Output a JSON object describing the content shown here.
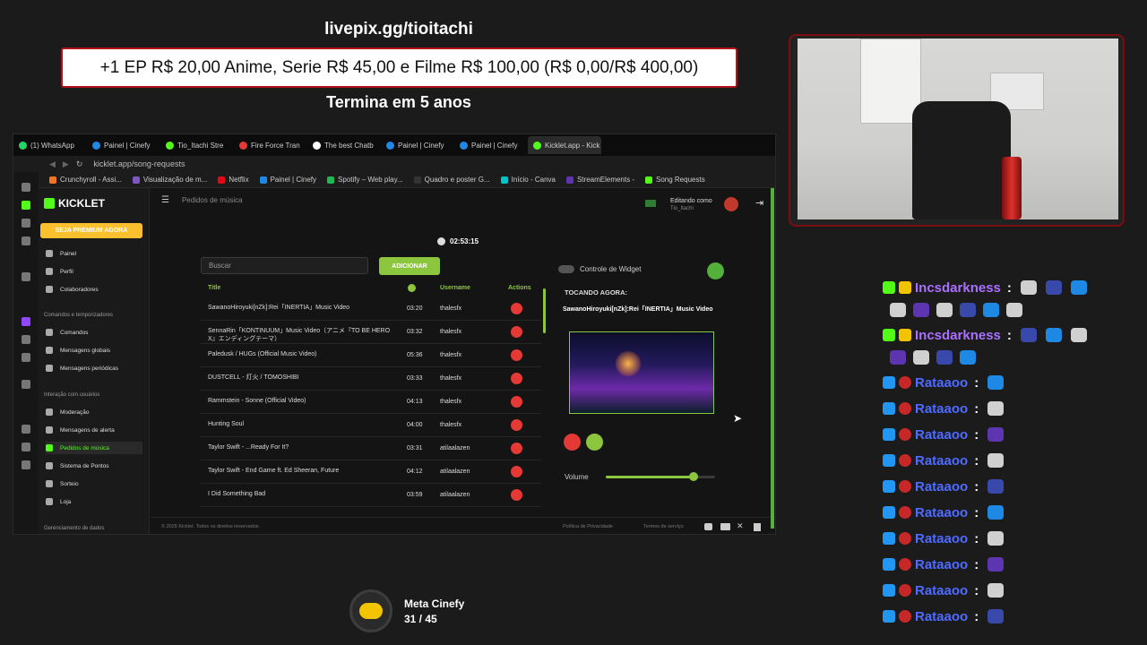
{
  "overlay": {
    "donation_url": "livepix.gg/tioitachi",
    "goal_text": "+1 EP R$ 20,00 Anime, Serie R$ 45,00 e Filme R$ 100,00 (R$ 0,00/R$ 400,00)",
    "ends_text": "Termina em 5 anos"
  },
  "browser": {
    "tabs": [
      {
        "label": "(1) WhatsApp",
        "color": "#25d366"
      },
      {
        "label": "Painel | Cinefy",
        "color": "#1e88e5"
      },
      {
        "label": "Tio_Itachi Stre",
        "color": "#53fc18"
      },
      {
        "label": "Fire Force Tran",
        "color": "#e53935"
      },
      {
        "label": "The best Chatb",
        "color": "#ffffff"
      },
      {
        "label": "Painel | Cinefy",
        "color": "#1e88e5"
      },
      {
        "label": "Painel | Cinefy",
        "color": "#1e88e5"
      },
      {
        "label": "Kicklet.app - Kick Cha",
        "color": "#53fc18",
        "active": true
      }
    ],
    "url": "kicklet.app/song-requests",
    "bookmarks": [
      {
        "label": "Crunchyroll - Assi...",
        "color": "#f47521"
      },
      {
        "label": "Visualização de m...",
        "color": "#7e57c2"
      },
      {
        "label": "Netflix",
        "color": "#e50914"
      },
      {
        "label": "Painel | Cinefy",
        "color": "#1e88e5"
      },
      {
        "label": "Spotify – Web play...",
        "color": "#1db954"
      },
      {
        "label": "Quadro e poster G...",
        "color": "#333333"
      },
      {
        "label": "Início - Canva",
        "color": "#00c4cc"
      },
      {
        "label": "StreamElements -",
        "color": "#5e35b1"
      },
      {
        "label": "Song Requests",
        "color": "#53fc18"
      }
    ]
  },
  "app": {
    "logo": "KICKLET",
    "premium_label": "SEJA PREMIUM AGORA",
    "menu_main": [
      "Painel",
      "Perfil",
      "Colaboradores"
    ],
    "section_commands": "Comandos e temporizadores",
    "menu_commands": [
      "Comandos",
      "Mensagens globais",
      "Mensagens periódicas"
    ],
    "section_interaction": "Interação com usuários",
    "menu_interaction": [
      "Moderação",
      "Mensagens de alerta",
      "Pedidos de música",
      "Sistema de Pontos",
      "Sorteio",
      "Loja"
    ],
    "section_data": "Gerenciamento de dados",
    "page_title": "Pedidos de música",
    "editing_as": "Editando como",
    "editing_user": "Tio_Itachi",
    "timer": "02:53:15",
    "search_placeholder": "Buscar",
    "add_label": "ADICIONAR",
    "columns": {
      "title": "Title",
      "username": "Username",
      "actions": "Actions"
    },
    "songs": [
      {
        "title": "SawanoHiroyuki[nZk]:Rei「INERTIA」Music Video",
        "duration": "03:20",
        "user": "thalesfx"
      },
      {
        "title": "SennaRin「KONTINUUM」Music Video（アニメ『TO BE HERO X』エンディングテーマ）",
        "duration": "03:32",
        "user": "thalesfx"
      },
      {
        "title": "Paledusk / HUGs (Official Music Video)",
        "duration": "05:36",
        "user": "thalesfx"
      },
      {
        "title": "DUSTCELL - 灯火 / TOMOSHIBI",
        "duration": "03:33",
        "user": "thalesfx"
      },
      {
        "title": "Rammstein - Sonne (Official Video)",
        "duration": "04:13",
        "user": "thalesfx"
      },
      {
        "title": "Hunting Soul",
        "duration": "04:00",
        "user": "thalesfx"
      },
      {
        "title": "Taylor Swift - ...Ready For It?",
        "duration": "03:31",
        "user": "atilaalazen"
      },
      {
        "title": "Taylor Swift - End Game ft. Ed Sheeran, Future",
        "duration": "04:12",
        "user": "atilaalazen"
      },
      {
        "title": "I Did Something Bad",
        "duration": "03:59",
        "user": "atilaalazen"
      }
    ],
    "widget_control": "Controle de Widget",
    "now_playing_head": "TOCANDO AGORA:",
    "now_playing_title": "SawanoHiroyuki[nZk]:Rei「INERTIA」Music Video",
    "volume_label": "Volume",
    "volume_level": 0.8,
    "footer_copy": "© 2025 Kicklet. Todos os direitos reservados.",
    "footer_privacy": "Política de Privacidade",
    "footer_terms": "Termos de serviço"
  },
  "chat": {
    "messages": [
      {
        "user": "Incsdarkness",
        "color": "#a970ff",
        "emotes": 9
      },
      {
        "user": "Incsdarkness",
        "color": "#a970ff",
        "emotes": 7
      },
      {
        "user": "Rataaoo",
        "color": "#4f6bff",
        "emotes": 1
      },
      {
        "user": "Rataaoo",
        "color": "#4f6bff",
        "emotes": 1
      },
      {
        "user": "Rataaoo",
        "color": "#4f6bff",
        "emotes": 1
      },
      {
        "user": "Rataaoo",
        "color": "#4f6bff",
        "emotes": 1
      },
      {
        "user": "Rataaoo",
        "color": "#4f6bff",
        "emotes": 1
      },
      {
        "user": "Rataaoo",
        "color": "#4f6bff",
        "emotes": 1
      },
      {
        "user": "Rataaoo",
        "color": "#4f6bff",
        "emotes": 1
      },
      {
        "user": "Rataaoo",
        "color": "#4f6bff",
        "emotes": 1
      },
      {
        "user": "Rataaoo",
        "color": "#4f6bff",
        "emotes": 1
      },
      {
        "user": "Rataaoo",
        "color": "#4f6bff",
        "emotes": 1
      }
    ]
  },
  "meta": {
    "label": "Meta Cinefy",
    "count": "31 / 45"
  }
}
